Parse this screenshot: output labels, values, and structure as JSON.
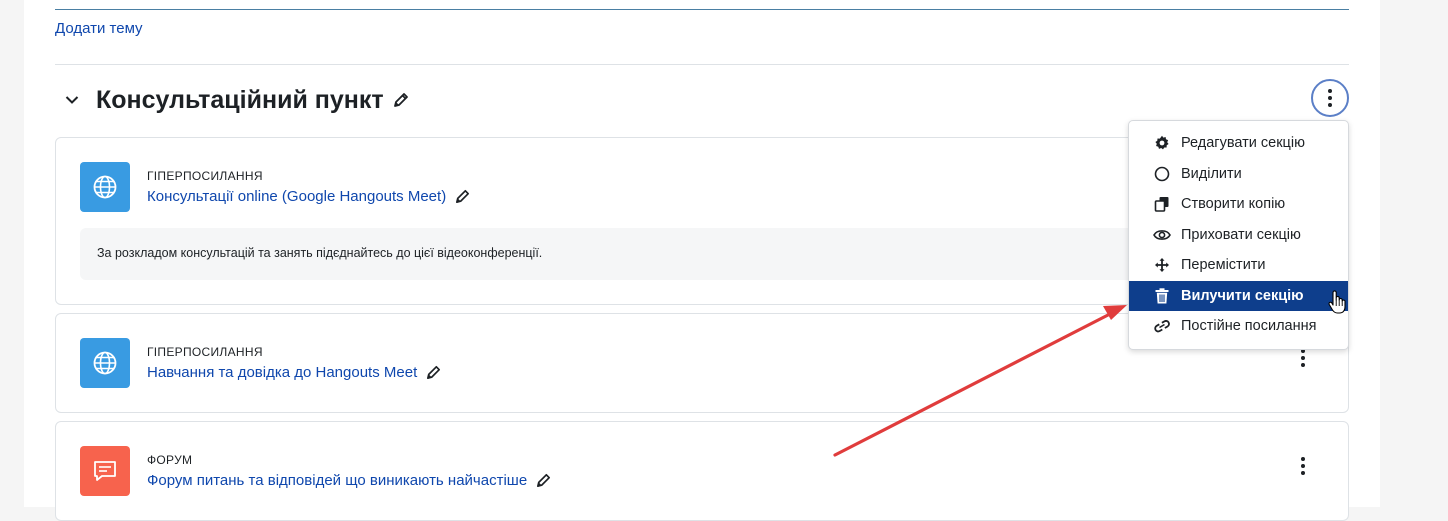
{
  "page": {
    "add_topic": "Додати тему"
  },
  "section": {
    "title": "Консультаційний пункт"
  },
  "activities": [
    {
      "type": "ГІПЕРПОСИЛАННЯ",
      "name": "Консультації online (Google Hangouts Meet)",
      "description": "За розкладом консультацій та занять підєднайтесь до цієї відеоконференції.",
      "icon": "globe-icon",
      "icon_color": "#399be2"
    },
    {
      "type": "ГІПЕРПОСИЛАННЯ",
      "name": "Навчання та довідка до Hangouts Meet",
      "icon": "globe-icon",
      "icon_color": "#399be2"
    },
    {
      "type": "ФОРУМ",
      "name": "Форум питань та відповідей що виникають найчастіше",
      "icon": "forum-icon",
      "icon_color": "#f7634d"
    }
  ],
  "menu": {
    "items": [
      {
        "label": "Редагувати секцію",
        "icon": "gear-icon"
      },
      {
        "label": "Виділити",
        "icon": "circle-icon"
      },
      {
        "label": "Створити копію",
        "icon": "copy-icon"
      },
      {
        "label": "Приховати секцію",
        "icon": "eye-icon"
      },
      {
        "label": "Перемістити",
        "icon": "move-icon"
      },
      {
        "label": "Вилучити секцію",
        "icon": "trash-icon",
        "highlighted": true
      },
      {
        "label": "Постійне посилання",
        "icon": "link-icon"
      }
    ]
  },
  "colors": {
    "link": "#0f47ad",
    "menu_highlight": "#0e3e8c",
    "annotation_arrow": "#e03c3c"
  }
}
